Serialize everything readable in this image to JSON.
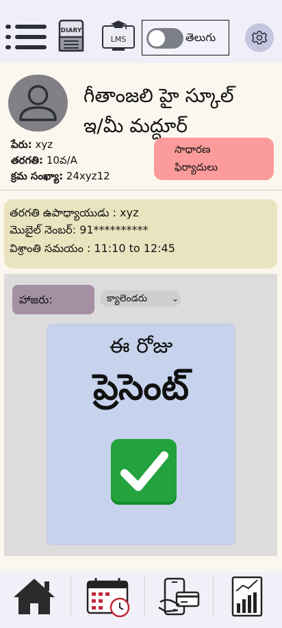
{
  "header": {
    "diary_label": "DIARY",
    "lms_label": "LMS",
    "language_label": "తెలుగు"
  },
  "school": {
    "name_line1": "గీతాంజలి హై స్కూల్",
    "name_line2": "ఇ/మీ మద్దూర్"
  },
  "student": {
    "name_label": "పేరు:",
    "name_value": "xyz",
    "class_label": "తరగతి:",
    "class_value": "10వ/A",
    "roll_label": "క్రమ సంఖ్యా:",
    "roll_value": "24xyz12"
  },
  "complaint_button": {
    "line1": "సాధారణ",
    "line2": "ఫిర్యాదులు"
  },
  "teacher_info": {
    "teacher_line": "తరగతి ఉపాధ్యాయుడు : xyz",
    "mobile_line": "మొబైల్ నెంబర్: 91**********",
    "break_line": "విశ్రాంతి సమయం : 11:10 to 12:45"
  },
  "attendance": {
    "label": "హాజరు:",
    "calendar_select": "క్యాలెండరు",
    "today_text": "ఈ రోజు",
    "status_text": "ప్రెసెంట్"
  }
}
